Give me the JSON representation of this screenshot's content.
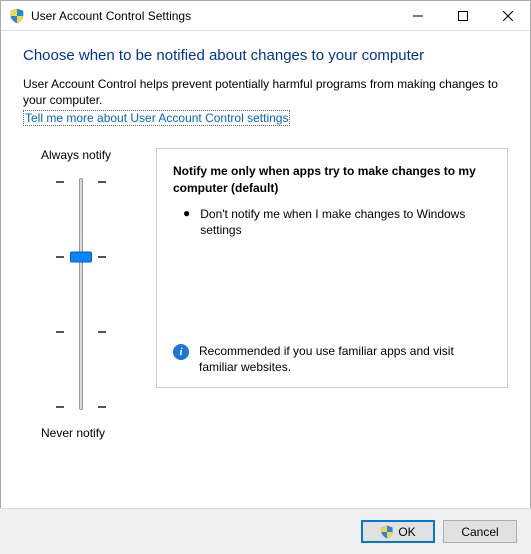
{
  "window": {
    "title": "User Account Control Settings"
  },
  "heading": "Choose when to be notified about changes to your computer",
  "description": "User Account Control helps prevent potentially harmful programs from making changes to your computer.",
  "link_text": "Tell me more about User Account Control settings",
  "slider": {
    "top_label": "Always notify",
    "bottom_label": "Never notify",
    "levels": 4,
    "current_level": 2
  },
  "panel": {
    "title": "Notify me only when apps try to make changes to my computer (default)",
    "bullet": "Don't notify me when I make changes to Windows settings",
    "recommendation": "Recommended if you use familiar apps and visit familiar websites."
  },
  "buttons": {
    "ok": "OK",
    "cancel": "Cancel"
  }
}
